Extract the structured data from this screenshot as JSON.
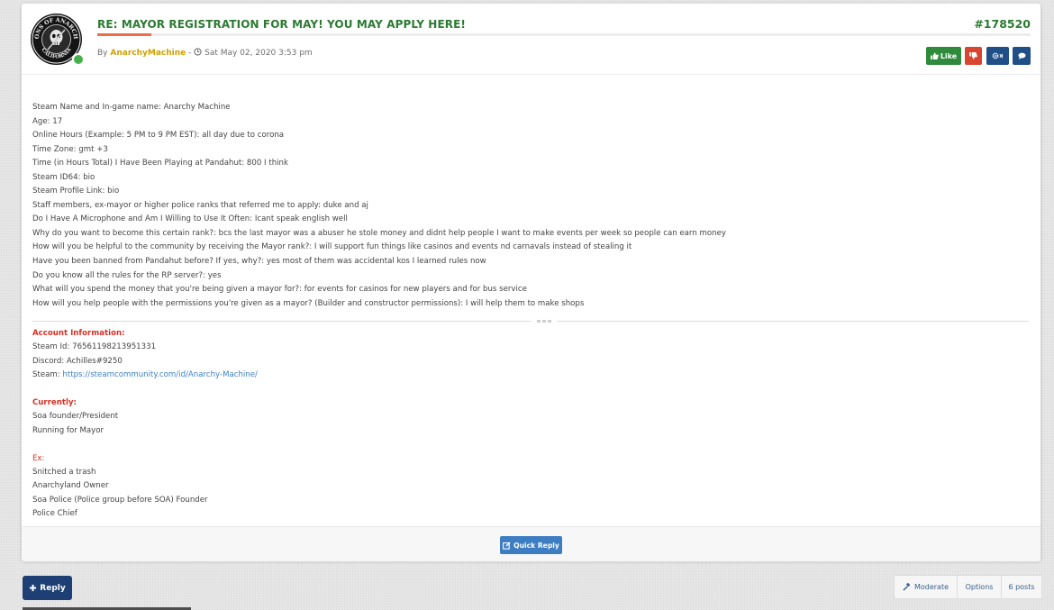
{
  "post": {
    "title": "RE: MAYOR REGISTRATION FOR MAY! YOU MAY APPLY HERE!",
    "id": "#178520",
    "by_label": "By",
    "author": "AnarchyMachine",
    "separator": " - ",
    "date": "Sat May 02, 2020 3:53 pm",
    "avatar_ring_text": "SONS OF ANARCHY",
    "avatar_bottom_text": "CALIFORNIA",
    "author_online": true
  },
  "actions": {
    "like_label": "Like",
    "like_icon": "thumbs-up-icon",
    "dislike_icon": "thumbs-down-icon",
    "tools_icon": "gear-icon",
    "chat_icon": "speech-bubble-icon"
  },
  "body_lines": [
    "Steam Name and In-game name: Anarchy Machine",
    "Age: 17",
    "Online Hours (Example: 5 PM to 9 PM EST): all day due to corona",
    "Time Zone: gmt +3",
    "Time (in Hours Total) I Have Been Playing at Pandahut: 800 I think",
    "Steam ID64: bio",
    "Steam Profile Link: bio",
    "Staff members, ex-mayor or higher police ranks that referred me to apply: duke and aj",
    "Do I Have A Microphone and Am I Willing to Use It Often: Icant speak english well",
    "Why do you want to become this certain rank?: bcs the last mayor was a abuser he stole money and didnt help people I want to make events per week so people can earn money",
    "How will you be helpful to the community by receiving the Mayor rank?: I will support fun things like casinos and events nd carnavals instead of stealing it",
    "Have you been banned from Pandahut before? If yes, why?: yes most of them was accidental kos I learned rules now",
    "Do you know all the rules for the RP server?: yes",
    "What will you spend the money that you're being given a mayor for?: for events for casinos for new players and for bus service",
    "How will you help people with the permissions you're given as a mayor? (Builder and constructor permissions): I will help them to make shops"
  ],
  "signature": {
    "account_heading": "Account Information:",
    "steam_id": "Steam Id: 76561198213951331",
    "discord": "Discord: Achilles#9250",
    "steam_label": "Steam: ",
    "steam_link": "https://steamcommunity.com/id/Anarchy-Machine/",
    "currently_heading": "Currently:",
    "currently_lines": [
      "Soa founder/President",
      "Running for Mayor"
    ],
    "ex_heading": "Ex:",
    "ex_lines": [
      "Snitched a trash",
      "Anarchyland Owner",
      "Soa Police (Police group before SOA) Founder",
      "Police Chief"
    ]
  },
  "footer": {
    "quick_reply_label": "Quick Reply",
    "quick_reply_icon": "edit-icon"
  },
  "bottom_bar": {
    "reply_label": "Reply",
    "reply_icon": "plus-icon",
    "moderate_label": "Moderate",
    "moderate_icon": "gavel-icon",
    "options_label": "Options",
    "post_count": "6 posts"
  },
  "colors": {
    "title_green": "#2b7a32",
    "author_gold": "#d1a000",
    "signature_red": "#d93125",
    "link_blue": "#3b7fc4",
    "like_green": "#2f8a3b",
    "dislike_red": "#d9452f",
    "navy": "#1f4f86",
    "accent_orange": "#f06b46"
  }
}
